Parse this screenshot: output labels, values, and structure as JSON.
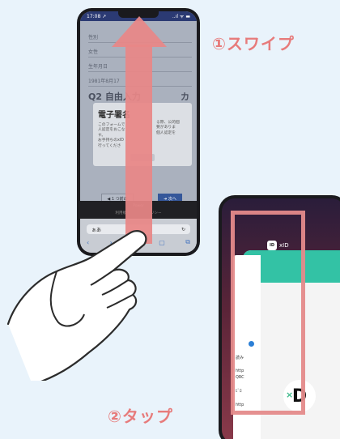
{
  "labels": {
    "swipe": "①スワイプ",
    "tap": "②タップ"
  },
  "phone1": {
    "status_time": "17:08 ↗",
    "status_icons": "..ıl ᯤ ▬",
    "form": {
      "gender_label": "性別",
      "gender_value": "女性",
      "birth_label": "生年月日",
      "birth_value": "1981年8月17",
      "question": "Q2 自由入力",
      "question_tail": "カ"
    },
    "dialog": {
      "title": "電子署名",
      "body_1": "このフォームで",
      "body_2": "人認定をおこな",
      "body_3": "す。",
      "body_4": "お手持ちのxID",
      "body_5": "行ってくださ",
      "body_right_1": "る際、公的個",
      "body_right_2": "要がありま",
      "body_right_3": "個人認定を"
    },
    "back_button": "◀ 1 つ前の",
    "next_button": "➜ 次へ",
    "footer_1": "Power",
    "footer_2": "利用規",
    "footer_3": "リシー",
    "url_text": "ぁあ",
    "reload_icon": "↻",
    "nav": [
      "‹",
      "›",
      "⇧",
      "▢",
      "⧉"
    ]
  },
  "phone2": {
    "app_name": "xID",
    "app_icon": "ID",
    "snippets": {
      "s1": "読み",
      "s2": "http",
      "s3": "QRC",
      "s4": "ﾋﾞﾛ",
      "s5": "http"
    },
    "logo_letter": "D",
    "logo_x": "×"
  },
  "colors": {
    "accent_red": "#e88787",
    "label_red": "#e77b7b",
    "xid_green": "#33c2a5",
    "background": "#e9f3fb"
  }
}
